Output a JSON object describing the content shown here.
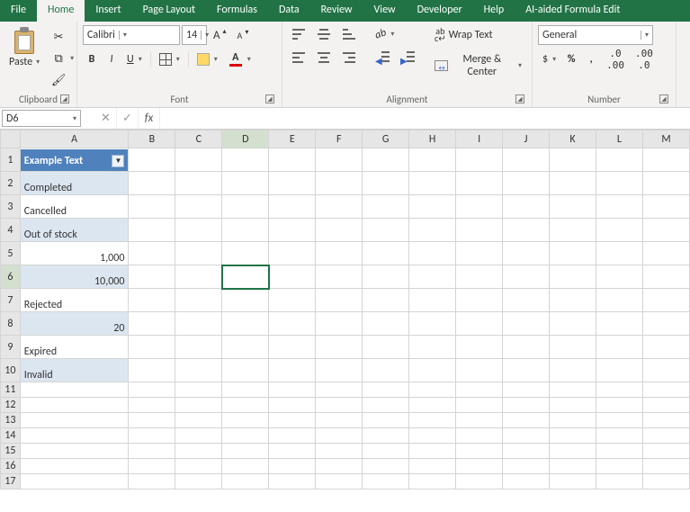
{
  "tabs": [
    "File",
    "Home",
    "Insert",
    "Page Layout",
    "Formulas",
    "Data",
    "Review",
    "View",
    "Developer",
    "Help",
    "AI-aided Formula Edit"
  ],
  "active_tab": "Home",
  "clipboard": {
    "paste": "Paste",
    "group": "Clipboard"
  },
  "font": {
    "name": "Calibri",
    "size": "14",
    "group": "Font"
  },
  "alignment": {
    "wrap": "Wrap Text",
    "merge": "Merge & Center",
    "group": "Alignment"
  },
  "number": {
    "format": "General",
    "group": "Number"
  },
  "namebox": "D6",
  "formula": "",
  "columns": [
    "A",
    "B",
    "C",
    "D",
    "E",
    "F",
    "G",
    "H",
    "I",
    "J",
    "K",
    "L",
    "M"
  ],
  "table_header": "Example Text",
  "rows": [
    {
      "n": 1,
      "a": "",
      "header": true
    },
    {
      "n": 2,
      "a": "Completed",
      "band": "a"
    },
    {
      "n": 3,
      "a": "Cancelled",
      "band": "b"
    },
    {
      "n": 4,
      "a": "Out of stock",
      "band": "a"
    },
    {
      "n": 5,
      "a": "1,000",
      "band": "b",
      "num": true
    },
    {
      "n": 6,
      "a": "10,000",
      "band": "a",
      "num": true
    },
    {
      "n": 7,
      "a": "Rejected",
      "band": "b"
    },
    {
      "n": 8,
      "a": "20",
      "band": "a",
      "num": true
    },
    {
      "n": 9,
      "a": "Expired",
      "band": "b"
    },
    {
      "n": 10,
      "a": "Invalid",
      "band": "a"
    },
    {
      "n": 11,
      "a": ""
    },
    {
      "n": 12,
      "a": ""
    },
    {
      "n": 13,
      "a": ""
    },
    {
      "n": 14,
      "a": ""
    },
    {
      "n": 15,
      "a": ""
    },
    {
      "n": 16,
      "a": ""
    },
    {
      "n": 17,
      "a": ""
    }
  ],
  "active_cell": {
    "row": 6,
    "col": "D"
  }
}
